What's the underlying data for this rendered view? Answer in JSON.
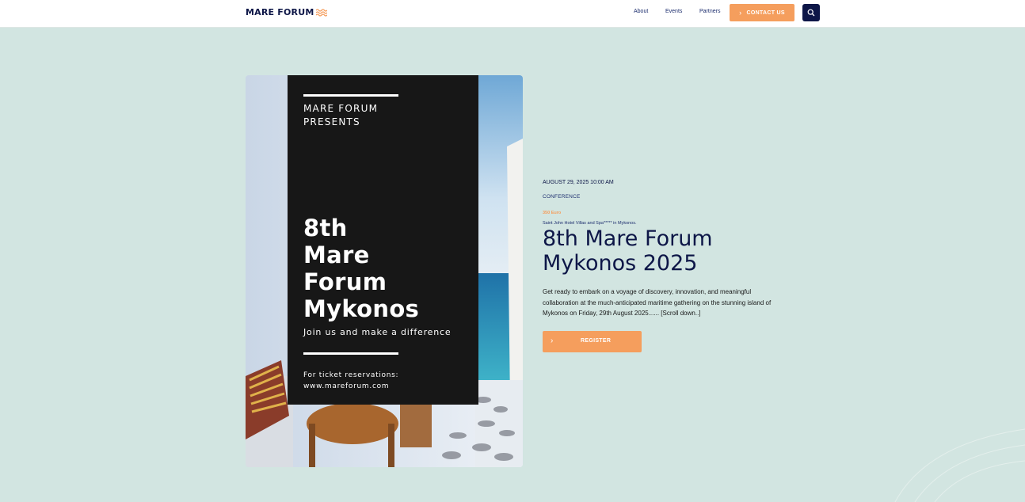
{
  "header": {
    "logo_text": "MARE FORUM",
    "nav": [
      {
        "label": "About"
      },
      {
        "label": "Events"
      },
      {
        "label": "Partners"
      }
    ],
    "contact_label": "CONTACT US"
  },
  "poster": {
    "presents_line1": "MARE FORUM",
    "presents_line2": "PRESENTS",
    "title_lines": [
      "8th",
      "Mare",
      "Forum",
      "Mykonos"
    ],
    "tagline": "Join us and make a difference",
    "tickets_line1": "For ticket reservations:",
    "tickets_line2": "www.mareforum.com"
  },
  "event": {
    "date": "AUGUST 29, 2025 10:00 AM",
    "type": "CONFERENCE",
    "price": "350 Euro",
    "venue": "Saint John Hotel Villas and Spa***** in Mykonos.",
    "title_line1": "8th Mare Forum",
    "title_line2": "Mykonos 2025",
    "description": "Get ready to embark on a voyage of discovery, innovation, and meaningful collaboration at the much-anticipated maritime gathering on the stunning island of Mykonos on Friday, 29th August 2025...... [Scroll down..]",
    "register_label": "REGISTER"
  },
  "colors": {
    "background": "#d2e5e1",
    "navy": "#0d1647",
    "accent": "#f59e5d"
  }
}
